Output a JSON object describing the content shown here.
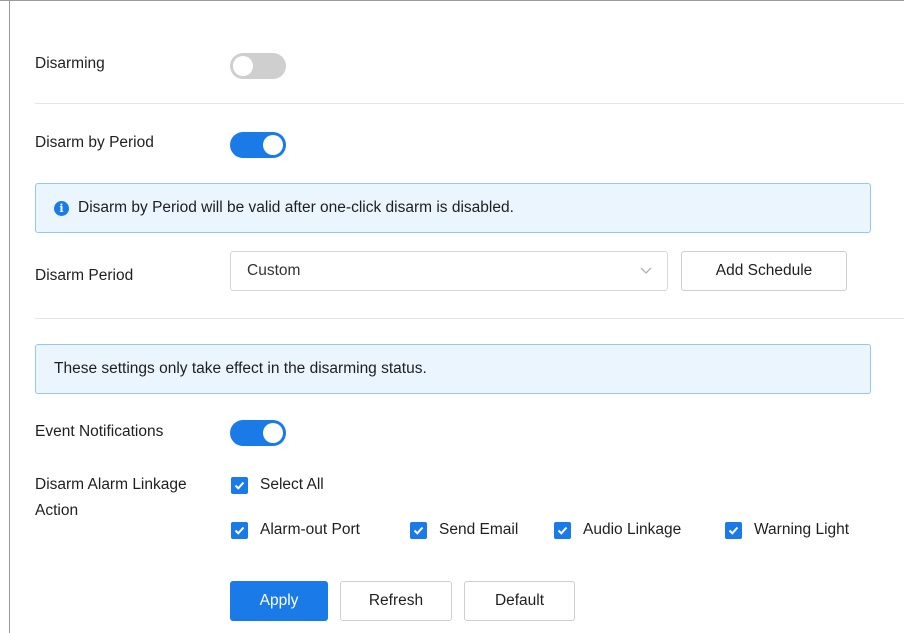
{
  "disarming": {
    "label": "Disarming",
    "enabled": false
  },
  "disarm_by_period": {
    "label": "Disarm by Period",
    "enabled": true,
    "notice": "Disarm by Period will be valid after one-click disarm is disabled."
  },
  "disarm_period": {
    "label": "Disarm Period",
    "selected": "Custom",
    "add_schedule_label": "Add Schedule"
  },
  "status_notice": "These settings only take effect in the disarming status.",
  "event_notifications": {
    "label": "Event Notifications",
    "enabled": true
  },
  "linkage": {
    "label_line1": "Disarm Alarm Linkage",
    "label_line2": "Action",
    "select_all": "Select All",
    "options": [
      "Alarm-out Port",
      "Send Email",
      "Audio Linkage",
      "Warning Light"
    ],
    "checked": [
      true,
      true,
      true,
      true
    ]
  },
  "actions": {
    "apply": "Apply",
    "refresh": "Refresh",
    "default": "Default"
  },
  "colors": {
    "accent": "#1a7ae8",
    "notice_bg": "#eaf5fd",
    "notice_border": "#94c8ef",
    "toggle_off": "#cfcfcf"
  },
  "icons": {
    "info": "info-icon",
    "dropdown": "chevron-down-icon",
    "check": "checkmark-icon"
  }
}
